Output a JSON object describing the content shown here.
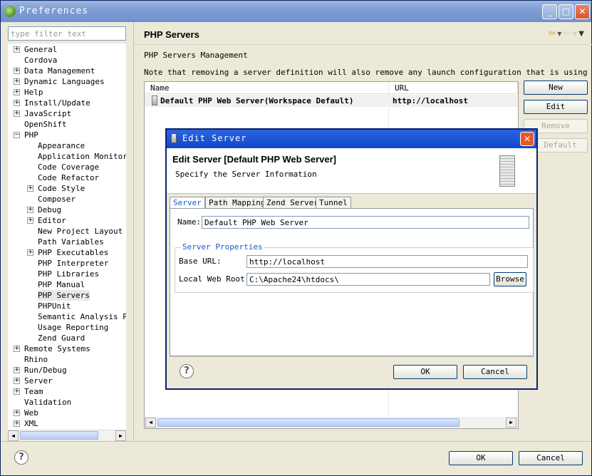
{
  "window": {
    "title": "Preferences"
  },
  "filter": {
    "placeholder": "type filter text"
  },
  "tree": [
    {
      "label": "General",
      "level": 0,
      "expandable": true
    },
    {
      "label": "Cordova",
      "level": 0,
      "expandable": false
    },
    {
      "label": "Data Management",
      "level": 0,
      "expandable": true
    },
    {
      "label": "Dynamic Languages",
      "level": 0,
      "expandable": true
    },
    {
      "label": "Help",
      "level": 0,
      "expandable": true
    },
    {
      "label": "Install/Update",
      "level": 0,
      "expandable": true
    },
    {
      "label": "JavaScript",
      "level": 0,
      "expandable": true
    },
    {
      "label": "OpenShift",
      "level": 0,
      "expandable": false
    },
    {
      "label": "PHP",
      "level": 0,
      "expandable": true,
      "expanded": true
    },
    {
      "label": "Appearance",
      "level": 1,
      "expandable": false
    },
    {
      "label": "Application Monitorin",
      "level": 1,
      "expandable": false
    },
    {
      "label": "Code Coverage",
      "level": 1,
      "expandable": false
    },
    {
      "label": "Code Refactor",
      "level": 1,
      "expandable": false
    },
    {
      "label": "Code Style",
      "level": 1,
      "expandable": true
    },
    {
      "label": "Composer",
      "level": 1,
      "expandable": false
    },
    {
      "label": "Debug",
      "level": 1,
      "expandable": true
    },
    {
      "label": "Editor",
      "level": 1,
      "expandable": true
    },
    {
      "label": "New Project Layout",
      "level": 1,
      "expandable": false
    },
    {
      "label": "Path Variables",
      "level": 1,
      "expandable": false
    },
    {
      "label": "PHP Executables",
      "level": 1,
      "expandable": true
    },
    {
      "label": "PHP Interpreter",
      "level": 1,
      "expandable": false
    },
    {
      "label": "PHP Libraries",
      "level": 1,
      "expandable": false
    },
    {
      "label": "PHP Manual",
      "level": 1,
      "expandable": false
    },
    {
      "label": "PHP Servers",
      "level": 1,
      "expandable": false,
      "selected": true
    },
    {
      "label": "PHPUnit",
      "level": 1,
      "expandable": false
    },
    {
      "label": "Semantic Analysis Pro",
      "level": 1,
      "expandable": false
    },
    {
      "label": "Usage Reporting",
      "level": 1,
      "expandable": false
    },
    {
      "label": "Zend Guard",
      "level": 1,
      "expandable": false
    },
    {
      "label": "Remote Systems",
      "level": 0,
      "expandable": true
    },
    {
      "label": "Rhino",
      "level": 0,
      "expandable": false
    },
    {
      "label": "Run/Debug",
      "level": 0,
      "expandable": true
    },
    {
      "label": "Server",
      "level": 0,
      "expandable": true
    },
    {
      "label": "Team",
      "level": 0,
      "expandable": true
    },
    {
      "label": "Validation",
      "level": 0,
      "expandable": false
    },
    {
      "label": "Web",
      "level": 0,
      "expandable": true
    },
    {
      "label": "XML",
      "level": 0,
      "expandable": true
    }
  ],
  "page": {
    "title": "PHP Servers",
    "management_label": "PHP Servers Management",
    "note": "Note that removing a server definition will also remove any launch configuration that is using it.",
    "table": {
      "columns": [
        "Name",
        "URL"
      ],
      "rows": [
        {
          "name": "Default PHP Web Server(Workspace Default)",
          "url": "http://localhost"
        }
      ]
    },
    "buttons": {
      "new": "New",
      "edit": "Edit",
      "remove": "Remove",
      "set_default": "t Default"
    }
  },
  "footer": {
    "ok": "OK",
    "cancel": "Cancel",
    "help": "?"
  },
  "dialog": {
    "title": "Edit Server",
    "heading": "Edit Server [Default PHP Web Server]",
    "subheading": "Specify the Server Information",
    "tabs": [
      "Server",
      "Path Mapping",
      "Zend Server",
      "Tunnel"
    ],
    "name_label": "Name:",
    "name_value": "Default PHP Web Server",
    "group_title": "Server Properties",
    "base_url_label": "Base URL:",
    "base_url_value": "http://localhost",
    "root_label": "Local Web Root:",
    "root_value": "C:\\Apache24\\htdocs\\",
    "browse": "Browse",
    "ok": "OK",
    "cancel": "Cancel",
    "help": "?",
    "close": "✕"
  },
  "titlebar_buttons": {
    "minimize": "_",
    "maximize": "□",
    "close": "✕"
  }
}
